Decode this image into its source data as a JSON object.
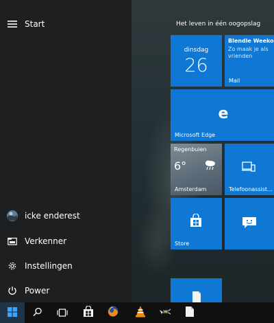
{
  "left_menu": {
    "start_label": "Start",
    "user_name": "icke enderest",
    "explorer_label": "Verkenner",
    "settings_label": "Instellingen",
    "power_label": "Power"
  },
  "tiles_group": {
    "title": "Het leven in één oogopslag"
  },
  "tiles": {
    "calendar": {
      "day": "dinsdag",
      "date": "26"
    },
    "mail": {
      "subject": "Blendle Weekover",
      "preview": "Zo maak je als\nvrienden",
      "label": "Mail"
    },
    "edge": {
      "label": "Microsoft Edge"
    },
    "weather": {
      "condition": "Regenbuien",
      "temp": "6°",
      "city": "Amsterdam"
    },
    "phone": {
      "label": "Telefoonassist..."
    },
    "store": {
      "label": "Store"
    },
    "feedback": {
      "label": ""
    }
  },
  "taskbar": {
    "items": [
      "start",
      "search",
      "task-view",
      "store",
      "firefox",
      "vlc",
      "app",
      "file"
    ]
  },
  "colors": {
    "accent": "#0f78d4",
    "start_pane": "#1e1f20",
    "taskbar": "#101010"
  }
}
